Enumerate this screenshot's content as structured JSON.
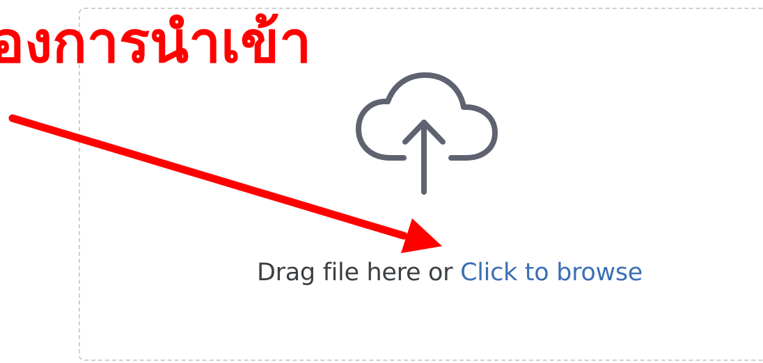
{
  "annotation": {
    "text": "้องการนำเข้า",
    "color": "#ff0000"
  },
  "dropzone": {
    "icon": "cloud-upload-icon",
    "icon_color": "#5f6370",
    "drag_text": "Drag file here or ",
    "browse_label": "Click to browse",
    "border_color": "#cfcfcf",
    "link_color": "#3b6fb6"
  }
}
